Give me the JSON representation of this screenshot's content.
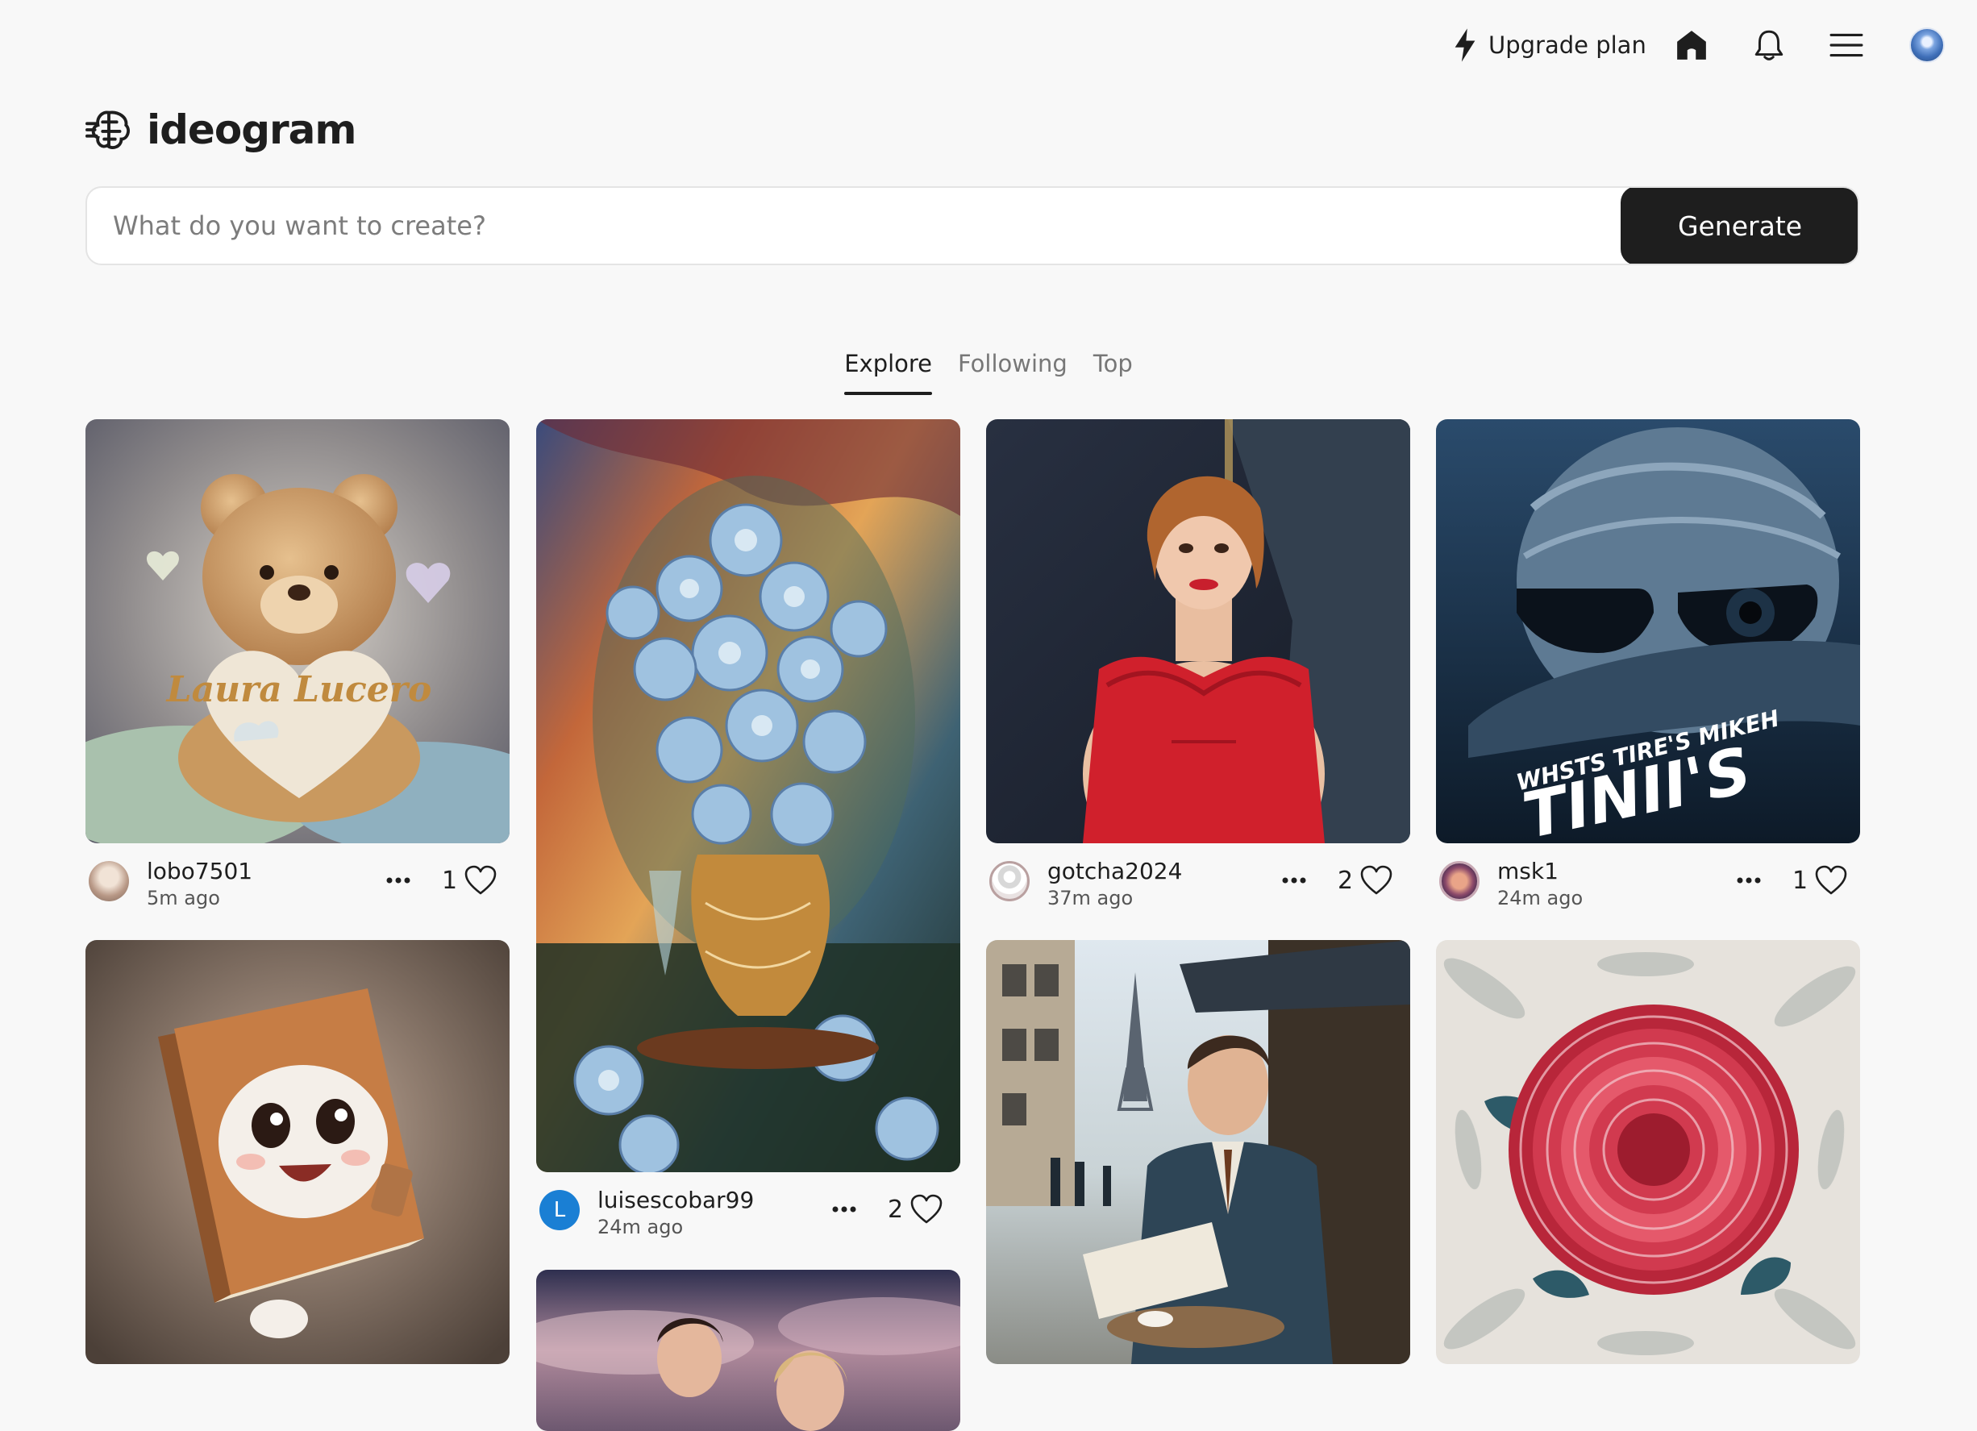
{
  "header": {
    "upgrade_label": "Upgrade plan",
    "icons": [
      "bolt-icon",
      "home-icon",
      "bell-icon",
      "hamburger-menu-icon",
      "user-avatar"
    ]
  },
  "logo": {
    "text": "ideogram"
  },
  "search": {
    "placeholder": "What do you want to create?",
    "value": "",
    "button_label": "Generate"
  },
  "tabs": [
    {
      "label": "Explore",
      "active": true
    },
    {
      "label": "Following",
      "active": false
    },
    {
      "label": "Top",
      "active": false
    }
  ],
  "feed": [
    {
      "user": "lobo7501",
      "time": "5m ago",
      "likes": "1",
      "image": "teddy bear holding heart",
      "image_text": "Laura Lucero"
    },
    {
      "user": "luisescobar99",
      "time": "24m ago",
      "likes": "2",
      "avatar_letter": "L",
      "image": "blue roses in vase painting"
    },
    {
      "user": "gotcha2024",
      "time": "37m ago",
      "likes": "2",
      "image": "woman in red strapless dress"
    },
    {
      "user": "msk1",
      "time": "24m ago",
      "likes": "1",
      "image": "tire graphic with sunglasses",
      "image_text": [
        "WHSTS TIRE'S MIKEH",
        "TINII'S"
      ]
    },
    {
      "user": "",
      "time": "",
      "likes": "",
      "image": "cute cartoon book character"
    },
    {
      "user": "",
      "time": "",
      "likes": "",
      "image": "man reading newspaper at Paris cafe"
    },
    {
      "user": "",
      "time": "",
      "likes": "",
      "image": "red chrysanthemum on leaf pattern"
    },
    {
      "user": "",
      "time": "",
      "likes": "",
      "image": "movie poster with two people"
    }
  ],
  "colors": {
    "accent_dark": "#1e1e1e",
    "page_bg": "#f8f8f8",
    "avatar_blue": "#1a7fd4"
  }
}
